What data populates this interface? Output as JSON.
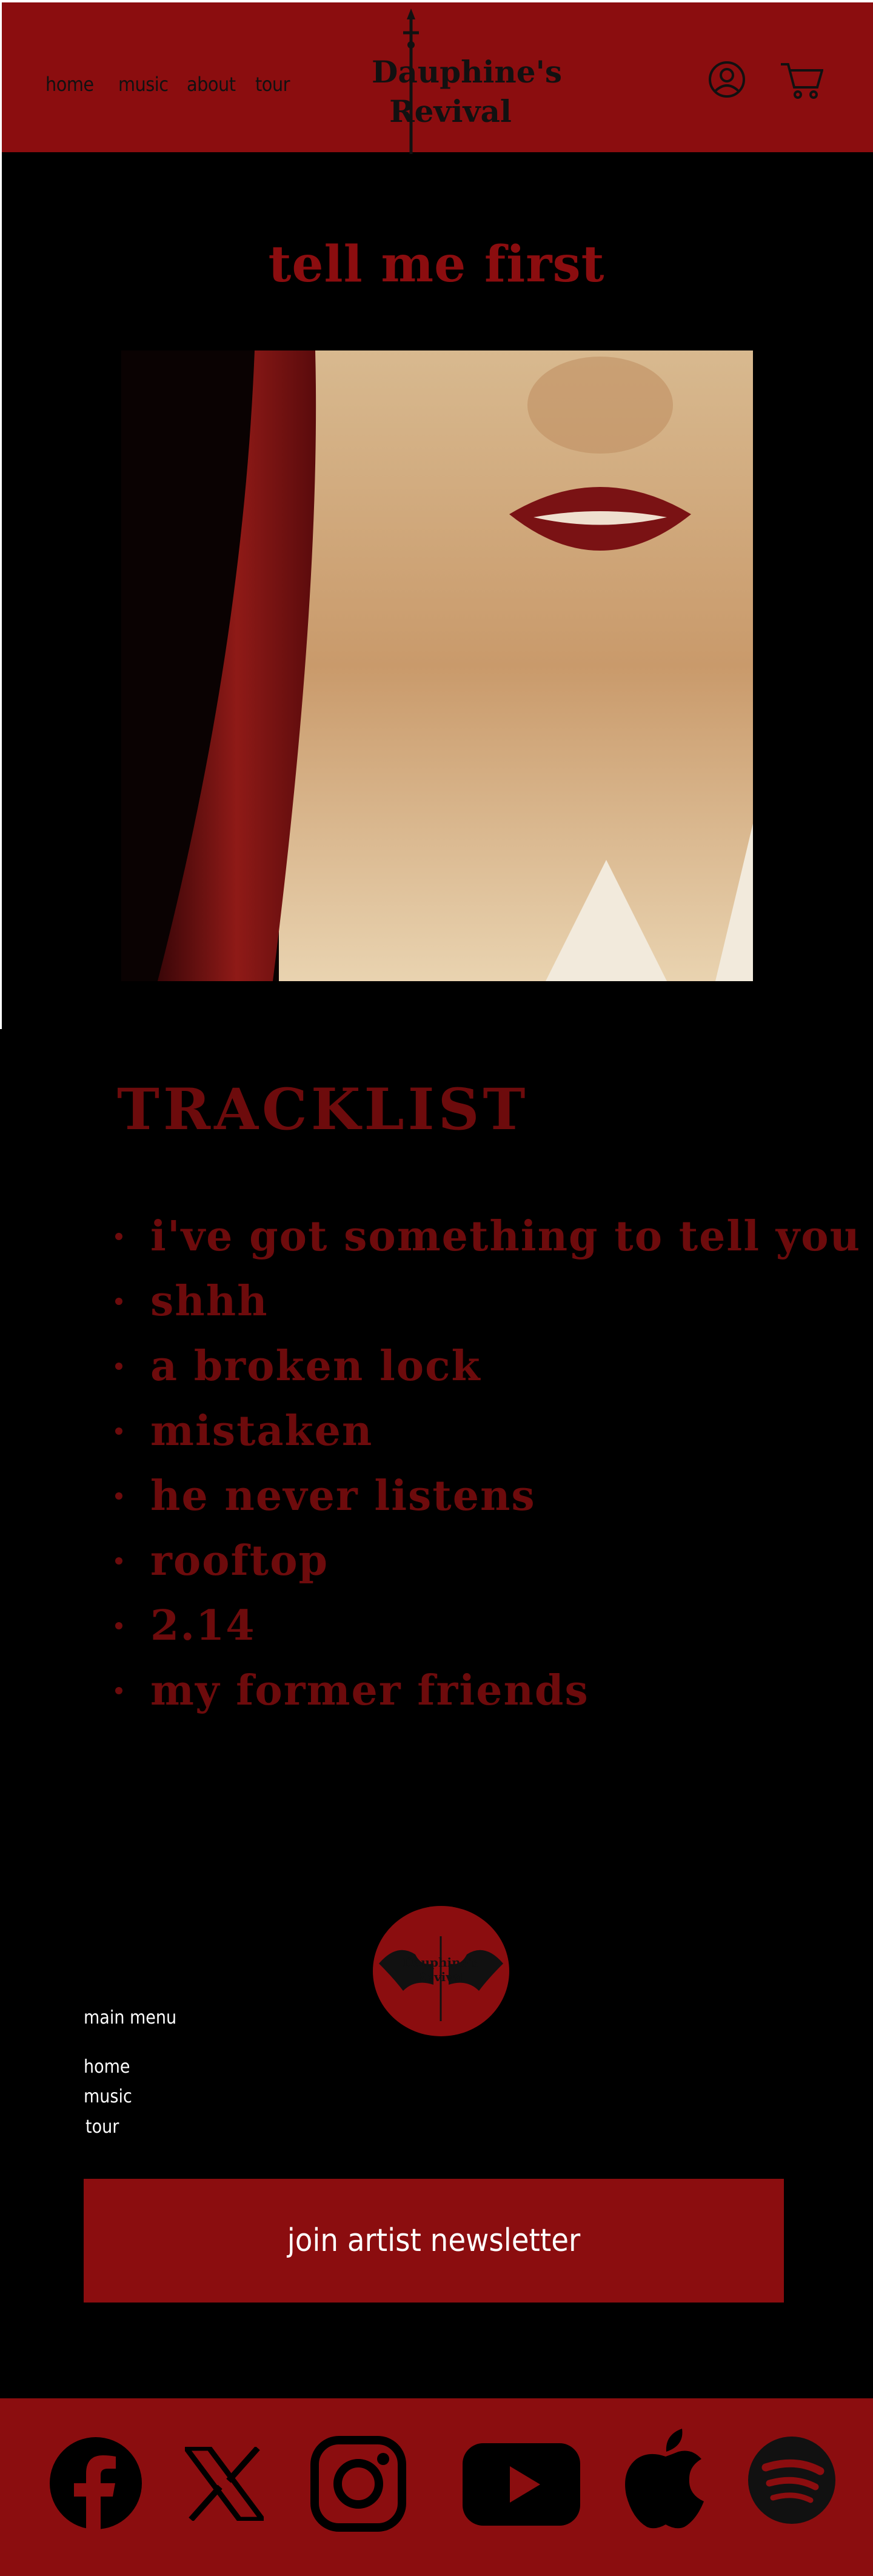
{
  "header": {
    "nav": [
      "home",
      "music",
      "about",
      "tour"
    ],
    "logo_line1": "Dauphine's",
    "logo_line2": "Revival",
    "account_icon": "user-circle-icon",
    "cart_icon": "shopping-cart-icon"
  },
  "album": {
    "title": "tell me first",
    "cover_icon": "album-cover-image"
  },
  "tracklist": {
    "heading": "TRACKLIST",
    "tracks": [
      "i've got something to tell you",
      "shhh",
      "a broken lock",
      "mistaken",
      "he never listens",
      "rooftop",
      "2.14",
      "my former friends"
    ]
  },
  "footer": {
    "logo_line1": "Dauphine's",
    "logo_line2": "Revival",
    "menu_heading": "main menu",
    "menu": [
      "home",
      "music",
      "tour"
    ],
    "newsletter_label": "join artist newsletter"
  },
  "social": [
    "facebook-icon",
    "x-icon",
    "instagram-icon",
    "youtube-icon",
    "apple-icon",
    "spotify-icon"
  ],
  "colors": {
    "brand_red": "#8b0d0f",
    "dark_red": "#6d0b0c",
    "background": "#000000"
  }
}
